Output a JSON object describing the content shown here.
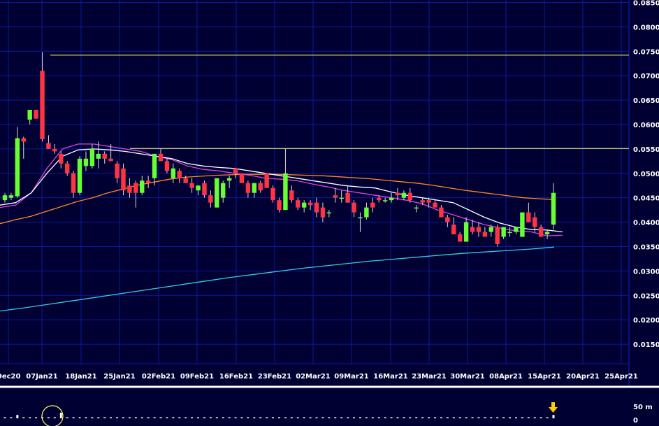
{
  "colors": {
    "background": "#000033",
    "grid": "#0d1a9a",
    "up_candle": "#66ff33",
    "down_candle": "#ff3344",
    "wick": "#dddddd",
    "axis_text": "#ffffff",
    "level_line": "#ffff66",
    "ma_short": "#ffffff",
    "ma_mid": "#dd44dd",
    "ma_long": "#ff8822",
    "ma_slow": "#33ccdd",
    "separator": "#ffffff",
    "alert_arrow": "#ffcc00"
  },
  "chart_data": {
    "type": "candlestick",
    "ylim": [
      0.011,
      0.0855
    ],
    "y_ticks": [
      "0.0850",
      "0.0800",
      "0.0750",
      "0.0700",
      "0.0650",
      "0.0600",
      "0.0550",
      "0.0500",
      "0.0450",
      "0.0400",
      "0.0350",
      "0.0300",
      "0.0250",
      "0.0200",
      "0.0150"
    ],
    "x_ticks": [
      "Dec20",
      "07Jan21",
      "18Jan21",
      "25Jan21",
      "02Feb21",
      "09Feb21",
      "16Feb21",
      "23Feb21",
      "02Mar21",
      "09Mar21",
      "16Mar21",
      "23Mar21",
      "30Mar21",
      "08Apr21",
      "15Apr21",
      "20Apr21",
      "25Apr21"
    ],
    "horizontal_levels": [
      0.0742,
      0.0551
    ],
    "candles": [
      [
        0.0445,
        0.046,
        0.044,
        0.0455
      ],
      [
        0.045,
        0.046,
        0.0445,
        0.0455
      ],
      [
        0.0453,
        0.0595,
        0.045,
        0.0572
      ],
      [
        0.0572,
        0.0575,
        0.053,
        0.0565
      ],
      [
        0.061,
        0.0615,
        0.06,
        0.063
      ],
      [
        0.063,
        0.063,
        0.0612,
        0.0612
      ],
      [
        0.071,
        0.0748,
        0.0565,
        0.057
      ],
      [
        0.0562,
        0.0578,
        0.055,
        0.055
      ],
      [
        0.055,
        0.056,
        0.054,
        0.0545
      ],
      [
        0.054,
        0.0545,
        0.051,
        0.052
      ],
      [
        0.052,
        0.0525,
        0.0495,
        0.05
      ],
      [
        0.05,
        0.0505,
        0.045,
        0.046
      ],
      [
        0.046,
        0.0535,
        0.0455,
        0.053
      ],
      [
        0.0515,
        0.0545,
        0.0505,
        0.053
      ],
      [
        0.0515,
        0.056,
        0.051,
        0.055
      ],
      [
        0.053,
        0.0565,
        0.051,
        0.054
      ],
      [
        0.054,
        0.0545,
        0.052,
        0.053
      ],
      [
        0.053,
        0.056,
        0.0525,
        0.0525
      ],
      [
        0.052,
        0.0525,
        0.048,
        0.049
      ],
      [
        0.051,
        0.052,
        0.0455,
        0.0465
      ],
      [
        0.0475,
        0.049,
        0.045,
        0.046
      ],
      [
        0.048,
        0.0485,
        0.043,
        0.046
      ],
      [
        0.046,
        0.0495,
        0.0455,
        0.0485
      ],
      [
        0.0485,
        0.0495,
        0.047,
        0.048
      ],
      [
        0.049,
        0.053,
        0.0475,
        0.054
      ],
      [
        0.054,
        0.055,
        0.0525,
        0.0525
      ],
      [
        0.0525,
        0.053,
        0.05,
        0.0505
      ],
      [
        0.049,
        0.052,
        0.048,
        0.051
      ],
      [
        0.0505,
        0.051,
        0.048,
        0.049
      ],
      [
        0.049,
        0.0495,
        0.048,
        0.048
      ],
      [
        0.048,
        0.049,
        0.046,
        0.047
      ],
      [
        0.0465,
        0.0475,
        0.0455,
        0.0475
      ],
      [
        0.048,
        0.0485,
        0.045,
        0.0455
      ],
      [
        0.0455,
        0.0465,
        0.043,
        0.044
      ],
      [
        0.043,
        0.048,
        0.043,
        0.049
      ],
      [
        0.045,
        0.0485,
        0.044,
        0.048
      ],
      [
        0.0485,
        0.0495,
        0.047,
        0.049
      ],
      [
        0.051,
        0.051,
        0.049,
        0.05
      ],
      [
        0.05,
        0.05,
        0.048,
        0.048
      ],
      [
        0.048,
        0.0485,
        0.045,
        0.046
      ],
      [
        0.046,
        0.048,
        0.045,
        0.048
      ],
      [
        0.048,
        0.0485,
        0.046,
        0.0465
      ],
      [
        0.05,
        0.05,
        0.047,
        0.047
      ],
      [
        0.047,
        0.0475,
        0.044,
        0.0445
      ],
      [
        0.0445,
        0.045,
        0.042,
        0.0425
      ],
      [
        0.0425,
        0.055,
        0.0425,
        0.05
      ],
      [
        0.0465,
        0.0475,
        0.044,
        0.0445
      ],
      [
        0.0445,
        0.045,
        0.0425,
        0.043
      ],
      [
        0.043,
        0.0445,
        0.042,
        0.044
      ],
      [
        0.044,
        0.0445,
        0.0425,
        0.0435
      ],
      [
        0.044,
        0.045,
        0.041,
        0.042
      ],
      [
        0.043,
        0.044,
        0.04,
        0.041
      ],
      [
        0.042,
        0.0425,
        0.041,
        0.042
      ],
      [
        0.0455,
        0.047,
        0.044,
        0.045
      ],
      [
        0.045,
        0.0465,
        0.044,
        0.045
      ],
      [
        0.046,
        0.0475,
        0.044,
        0.044
      ],
      [
        0.044,
        0.0445,
        0.041,
        0.042
      ],
      [
        0.041,
        0.042,
        0.038,
        0.041
      ],
      [
        0.041,
        0.044,
        0.0405,
        0.043
      ],
      [
        0.044,
        0.045,
        0.042,
        0.043
      ],
      [
        0.045,
        0.0455,
        0.044,
        0.0445
      ],
      [
        0.0445,
        0.045,
        0.044,
        0.0445
      ],
      [
        0.0445,
        0.046,
        0.044,
        0.045
      ],
      [
        0.046,
        0.047,
        0.0445,
        0.0455
      ],
      [
        0.045,
        0.0465,
        0.0445,
        0.046
      ],
      [
        0.046,
        0.047,
        0.044,
        0.0445
      ],
      [
        0.043,
        0.0435,
        0.042,
        0.043
      ],
      [
        0.0445,
        0.045,
        0.0435,
        0.044
      ],
      [
        0.0445,
        0.045,
        0.043,
        0.044
      ],
      [
        0.044,
        0.0445,
        0.043,
        0.043
      ],
      [
        0.043,
        0.0435,
        0.041,
        0.041
      ],
      [
        0.041,
        0.0415,
        0.039,
        0.04
      ],
      [
        0.0395,
        0.041,
        0.038,
        0.0375
      ],
      [
        0.0375,
        0.038,
        0.036,
        0.036
      ],
      [
        0.036,
        0.041,
        0.036,
        0.04
      ],
      [
        0.039,
        0.0405,
        0.0375,
        0.038
      ],
      [
        0.039,
        0.04,
        0.037,
        0.038
      ],
      [
        0.038,
        0.039,
        0.037,
        0.037
      ],
      [
        0.038,
        0.0395,
        0.037,
        0.039
      ],
      [
        0.039,
        0.0395,
        0.035,
        0.0355
      ],
      [
        0.037,
        0.039,
        0.0365,
        0.039
      ],
      [
        0.038,
        0.039,
        0.037,
        0.038
      ],
      [
        0.038,
        0.039,
        0.0375,
        0.039
      ],
      [
        0.037,
        0.042,
        0.037,
        0.042
      ],
      [
        0.042,
        0.044,
        0.04,
        0.04
      ],
      [
        0.041,
        0.042,
        0.038,
        0.039
      ],
      [
        0.039,
        0.0395,
        0.037,
        0.037
      ],
      [
        0.0375,
        0.0385,
        0.0365,
        0.038
      ],
      [
        0.0395,
        0.048,
        0.0385,
        0.046
      ]
    ],
    "ma_short": [
      0.0435,
      0.044,
      0.046,
      0.05,
      0.0535,
      0.0548,
      0.055,
      0.0548,
      0.0545,
      0.054,
      0.0535,
      0.053,
      0.052,
      0.0515,
      0.0512,
      0.051,
      0.0505,
      0.05,
      0.0495,
      0.049,
      0.0485,
      0.048,
      0.0475,
      0.0472,
      0.047,
      0.0462,
      0.0455,
      0.045,
      0.0445,
      0.044,
      0.0425,
      0.041,
      0.0398,
      0.039,
      0.0385,
      0.0384,
      0.038
    ],
    "ma_mid": [
      0.043,
      0.0435,
      0.046,
      0.051,
      0.055,
      0.056,
      0.056,
      0.0555,
      0.055,
      0.0545,
      0.0535,
      0.0528,
      0.0515,
      0.0508,
      0.0505,
      0.05,
      0.0496,
      0.049,
      0.0488,
      0.0485,
      0.0478,
      0.0472,
      0.0465,
      0.046,
      0.0455,
      0.045,
      0.0445,
      0.0438,
      0.0425,
      0.0415,
      0.0405,
      0.0395,
      0.0388,
      0.0382,
      0.038,
      0.0372,
      0.0373
    ],
    "ma_long": [
      0.0397,
      0.0405,
      0.0412,
      0.0422,
      0.0432,
      0.0442,
      0.045,
      0.046,
      0.0468,
      0.0476,
      0.0482,
      0.0488,
      0.0492,
      0.0494,
      0.0496,
      0.0497,
      0.0498,
      0.0498,
      0.0498,
      0.0497,
      0.0496,
      0.0495,
      0.0493,
      0.0491,
      0.0489,
      0.0486,
      0.0483,
      0.048,
      0.0476,
      0.0471,
      0.0466,
      0.0462,
      0.0458,
      0.0454,
      0.045,
      0.0448,
      0.0446
    ],
    "ma_slow": [
      0.0218,
      0.0224,
      0.0231,
      0.0238,
      0.0245,
      0.0252,
      0.0259,
      0.0266,
      0.0273,
      0.028,
      0.0287,
      0.0293,
      0.0299,
      0.0305,
      0.031,
      0.0315,
      0.032,
      0.0324,
      0.0328,
      0.0332,
      0.0336,
      0.0339,
      0.0342,
      0.0345,
      0.0349
    ],
    "volume_labels": [
      "50 m",
      "0"
    ],
    "volume_bars": [
      0.1,
      0,
      0.6,
      0.1,
      0.1,
      0.05,
      0.1,
      0.05,
      0.1,
      1,
      0.1,
      0.05,
      0.1,
      0.1,
      0.05,
      0.1,
      0.1,
      0.1,
      0.05,
      0.1,
      0.1,
      0.05,
      0.1,
      0.1,
      0.1,
      0.1,
      0.05,
      0.1,
      0.1,
      0.1,
      0.1,
      0.1,
      0.1,
      0.05,
      0.1,
      0.1,
      0.1,
      0.1,
      0.1,
      0.05,
      0.1,
      0.1,
      0.1,
      0.1,
      0.1,
      0.1,
      0.05,
      0.1,
      0.1,
      0.1,
      0.05,
      0.1,
      0.1,
      0.1,
      0.1,
      0.05,
      0.1,
      0.1,
      0.1,
      0.1,
      0.1,
      0.05,
      0.1,
      0.1,
      0.1,
      0.1,
      0.1,
      0.1,
      0.05,
      0.1,
      0.1,
      0.1,
      0.1,
      0.1,
      0.1,
      0.05,
      0.1,
      0.1,
      0.1,
      0.1,
      0.1,
      0.05,
      0.1,
      0.1,
      0.1,
      0.1,
      0.1,
      0.1,
      0.6
    ]
  }
}
